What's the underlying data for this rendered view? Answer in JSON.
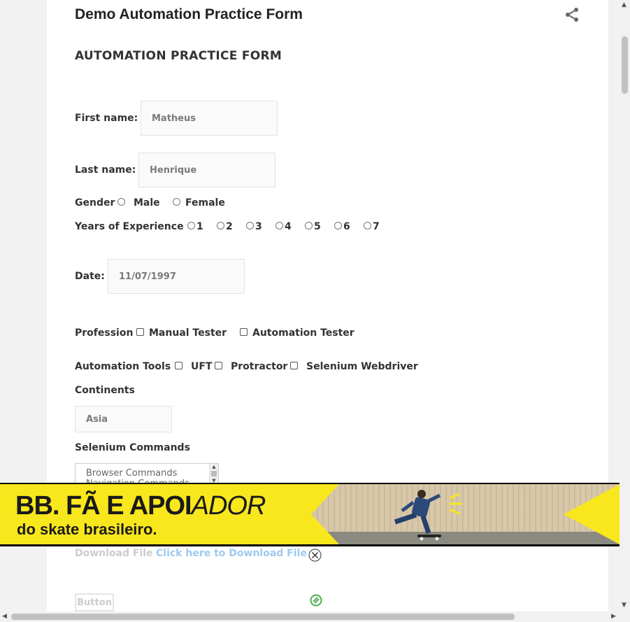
{
  "page": {
    "title": "Demo Automation Practice Form",
    "share_icon": "share-icon",
    "heading": "AUTOMATION PRACTICE FORM"
  },
  "form": {
    "first_name_label": "First name:",
    "first_name_value": "Matheus",
    "last_name_label": "Last name:",
    "last_name_value": "Henrique",
    "gender_label": "Gender",
    "gender_options": [
      "Male",
      "Female"
    ],
    "experience_label": "Years of Experience",
    "experience_options": [
      "1",
      "2",
      "3",
      "4",
      "5",
      "6",
      "7"
    ],
    "date_label": "Date:",
    "date_value": "11/07/1997",
    "profession_label": "Profession",
    "profession_options": [
      "Manual Tester",
      "Automation Tester"
    ],
    "tools_label": "Automation Tools",
    "tools_options": [
      "UFT",
      "Protractor",
      "Selenium Webdriver"
    ],
    "continents_label": "Continents",
    "continents_value": "Asia",
    "commands_label": "Selenium Commands",
    "commands_options": [
      "Browser Commands",
      "Navigation Commands"
    ],
    "download_label": "Download File",
    "download_link": "Click here to Download File",
    "button_label": "Button"
  },
  "ad": {
    "headline_part1": "BB. FÃ E APOI",
    "headline_part2": "ADOR",
    "subline": "do skate brasileiro.",
    "close_icon": "close-icon",
    "adchoices_icon": "adchoices-icon"
  },
  "colors": {
    "ad_yellow": "#f8e71c",
    "link": "#9ec9f0"
  }
}
